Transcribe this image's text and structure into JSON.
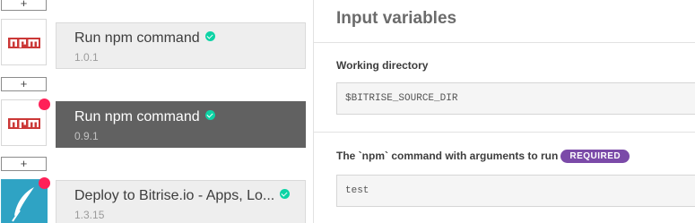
{
  "workflow": {
    "add_label": "+",
    "steps": [
      {
        "name": "Run npm command",
        "version": "1.0.1",
        "icon": "npm-logo-icon",
        "verified": true,
        "selected": false,
        "has_alert": false
      },
      {
        "name": "Run npm command",
        "version": "0.9.1",
        "icon": "npm-logo-icon",
        "verified": true,
        "selected": true,
        "has_alert": true
      },
      {
        "name": "Deploy to Bitrise.io - Apps, Lo...",
        "version": "1.3.15",
        "icon": "bitrise-deploy-feather-icon",
        "verified": true,
        "selected": false,
        "has_alert": true
      }
    ]
  },
  "inputs": {
    "title": "Input variables",
    "fields": [
      {
        "label": "Working directory",
        "value": "$BITRISE_SOURCE_DIR",
        "required": false
      },
      {
        "label": "The `npm` command with arguments to run",
        "value": "test",
        "required": true,
        "badge": "REQUIRED"
      }
    ]
  },
  "colors": {
    "npm_red": "#cb3837",
    "alert_dot": "#ff2158",
    "verified_green": "#0dd3a5",
    "selected_step_bg": "#616161",
    "required_badge": "#7b4aa8"
  }
}
